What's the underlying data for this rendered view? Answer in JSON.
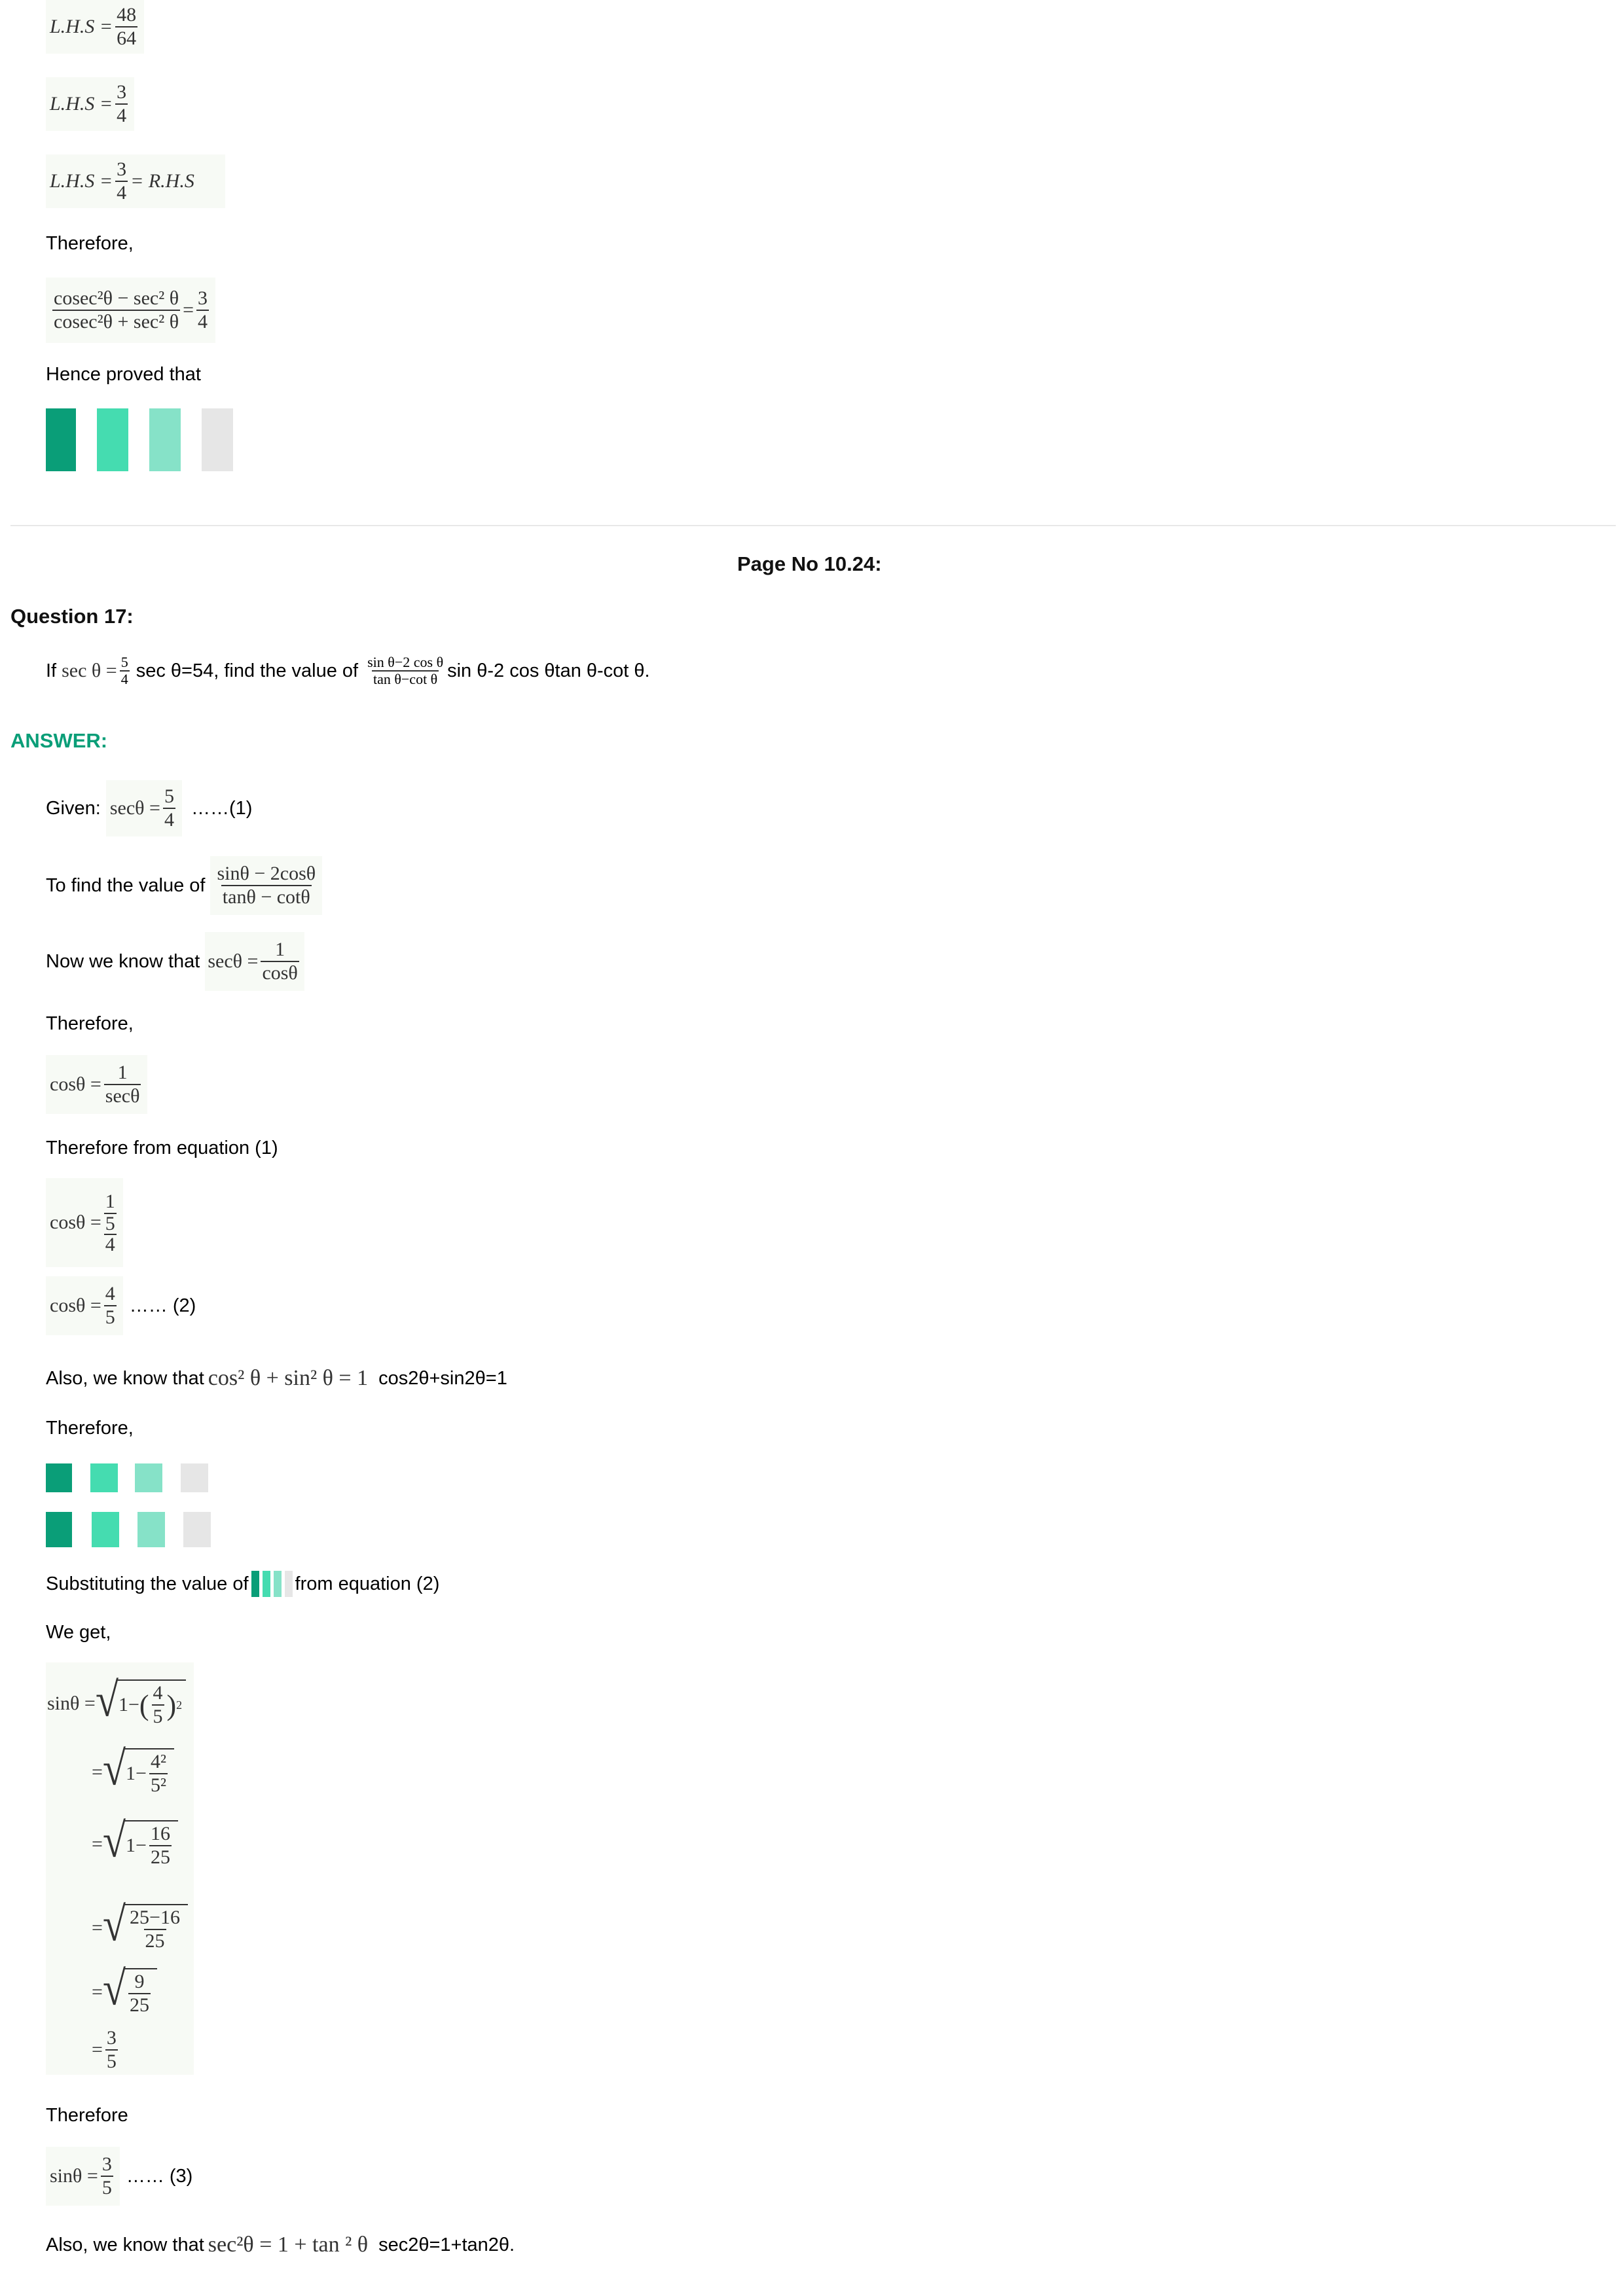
{
  "top": {
    "lhs1": {
      "lhs": "L.H.S =",
      "num": "48",
      "den": "64"
    },
    "lhs2": {
      "lhs": "L.H.S =",
      "num": "3",
      "den": "4"
    },
    "lhs3": {
      "lhs": "L.H.S =",
      "num": "3",
      "den": "4",
      "rhs": "= R.H.S"
    },
    "therefore": "Therefore,",
    "identity": {
      "num": "cosec²θ − sec² θ",
      "den": "cosec²θ + sec² θ",
      "eq": "=",
      "rnum": "3",
      "rden": "4"
    },
    "hence": "Hence proved that"
  },
  "page_no": "Page No 10.24:",
  "question": {
    "label": "Question 17:",
    "if": "If",
    "sec_theta": "sec θ =",
    "sec_num": "5",
    "sec_den": "4",
    "alt1": "sec θ=54, find the value of",
    "expr_num": "sin θ−2 cos θ",
    "expr_den": "tan θ−cot θ",
    "alt2": "sin θ-2 cos θtan θ-cot θ."
  },
  "answer_label": "ANSWER:",
  "steps": {
    "given_label": "Given:",
    "given_lhs": "secθ =",
    "given_num": "5",
    "given_den": "4",
    "given_tag": "……(1)",
    "tofind_label": "To find the value of",
    "tofind_num": "sinθ − 2cosθ",
    "tofind_den": "tanθ − cotθ",
    "know_label": "Now we know that",
    "know_lhs": "secθ =",
    "know_num": "1",
    "know_den": "cosθ",
    "therefore1": "Therefore,",
    "cos_lhs": "cosθ =",
    "cos_num": "1",
    "cos_den": "secθ",
    "therefore_eq1": "Therefore from equation (1)",
    "cos2_lhs": "cosθ =",
    "cos2_num": "1",
    "cos2_den_num": "5",
    "cos2_den_den": "4",
    "cos3_lhs": "cosθ =",
    "cos3_num": "4",
    "cos3_den": "5",
    "cos3_tag": "…… (2)",
    "also1_label": "Also, we know that",
    "also1_math": "cos² θ + sin² θ = 1",
    "also1_alt": "cos2θ+sin2θ=1",
    "therefore2": "Therefore,",
    "subst_a": "Substituting the value of",
    "subst_b": "from equation (2)",
    "weget": "We get,",
    "sin1_lhs": "sinθ =",
    "sin1_one": "1−",
    "sin1_num": "4",
    "sin1_den": "5",
    "sin1_exp": "2",
    "sin2_eq": "=",
    "sin2_one": "1−",
    "sin2_num": "4²",
    "sin2_den": "5²",
    "sin3_eq": "=",
    "sin3_one": "1−",
    "sin3_num": "16",
    "sin3_den": "25",
    "sin4_eq": "=",
    "sin4_num": "25−16",
    "sin4_den": "25",
    "sin5_eq": "=",
    "sin5_num": "9",
    "sin5_den": "25",
    "sin6_eq": "=",
    "sin6_num": "3",
    "sin6_den": "5",
    "therefore3": "Therefore",
    "sinf_lhs": "sinθ =",
    "sinf_num": "3",
    "sinf_den": "5",
    "sinf_tag": "…… (3)",
    "also2_label": "Also, we know that",
    "also2_math": "sec²θ = 1 + tan ² θ",
    "also2_alt": "sec2θ=1+tan2θ."
  },
  "colors": {
    "accent": "#0a9e78",
    "bar1": "#0a9e78",
    "bar2": "#45dcb0",
    "bar3": "#86e2c8",
    "bar4": "#e6e6e6"
  }
}
